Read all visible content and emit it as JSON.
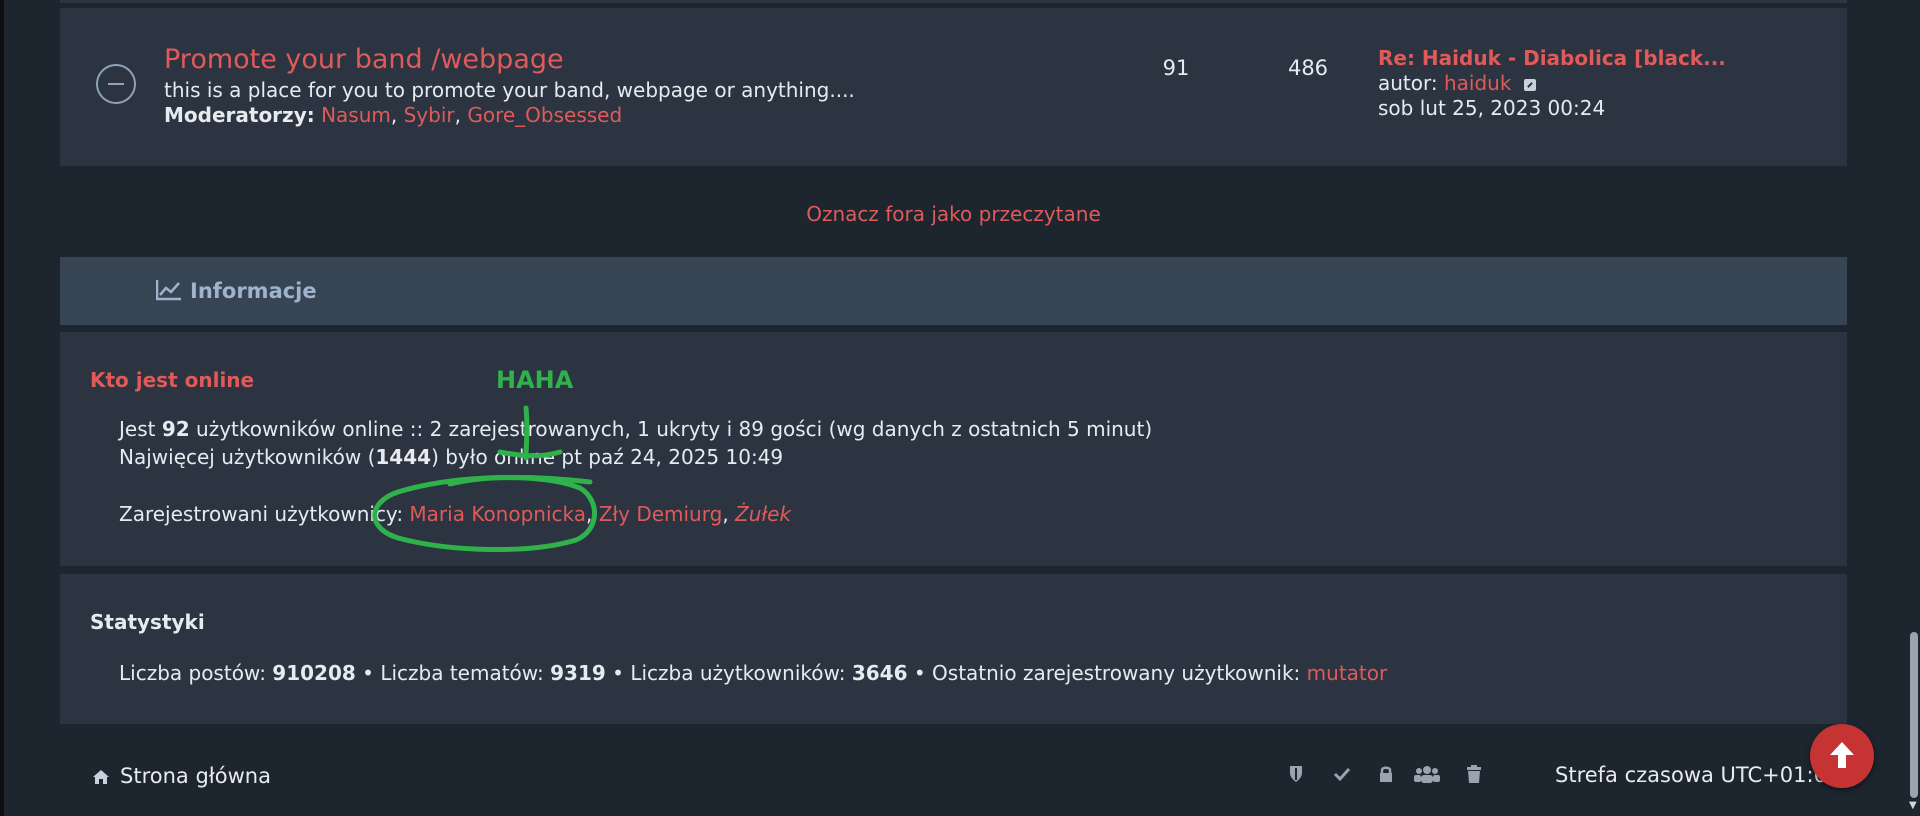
{
  "forum": {
    "title": "Promote your band /webpage",
    "description": "this is a place for you to promote your band, webpage or anything....",
    "moderators_label": "Moderatorzy:",
    "moderators": [
      "Nasum",
      "Sybir",
      "Gore_Obsessed"
    ],
    "separator": ",",
    "topics": "91",
    "posts": "486",
    "last_post": {
      "title": "Re: Haiduk - Diabolica [black...",
      "author_label": "autor:",
      "author": "haiduk",
      "date": "sob lut 25, 2023 00:24"
    }
  },
  "mark_read": "Oznacz fora jako przeczytane",
  "info": {
    "title": "Informacje",
    "icon": "chart-line-icon"
  },
  "online": {
    "heading": "Kto jest online",
    "line1": {
      "prefix": "Jest",
      "total": "92",
      "suffix": "użytkowników online :: 2 zarejestrowanych, 1 ukryty i 89 gości (wg danych z ostatnich 5 minut)"
    },
    "line2": {
      "prefix": "Najwięcej użytkowników (",
      "max": "1444",
      "suffix": ") było online pt paź 24, 2025 10:49"
    },
    "registered_label": "Zarejestrowani użytkownicy:",
    "users": [
      "Maria Konopnicka",
      "Zły Demiurg",
      "Żułek"
    ],
    "separator": ","
  },
  "stats": {
    "heading": "Statystyki",
    "posts_label": "Liczba postów:",
    "posts": "910208",
    "topics_label": "Liczba tematów:",
    "topics": "9319",
    "users_label": "Liczba użytkowników:",
    "users": "3646",
    "newest_label": "Ostatnio zarejestrowany użytkownik:",
    "newest": "mutator",
    "bullet": "•"
  },
  "footer": {
    "home": "Strona główna",
    "timezone": "Strefa czasowa UTC+01:00",
    "icons": [
      "shield-icon",
      "check-icon",
      "lock-icon",
      "users-icon",
      "trash-icon"
    ]
  },
  "annotation": {
    "text": "HAHA",
    "color": "#2fb24a"
  },
  "colors": {
    "accent": "#e05a5a",
    "panel": "#2b3440",
    "header": "#374453",
    "background": "#1d252f",
    "scroll_top_button": "#c63333"
  }
}
